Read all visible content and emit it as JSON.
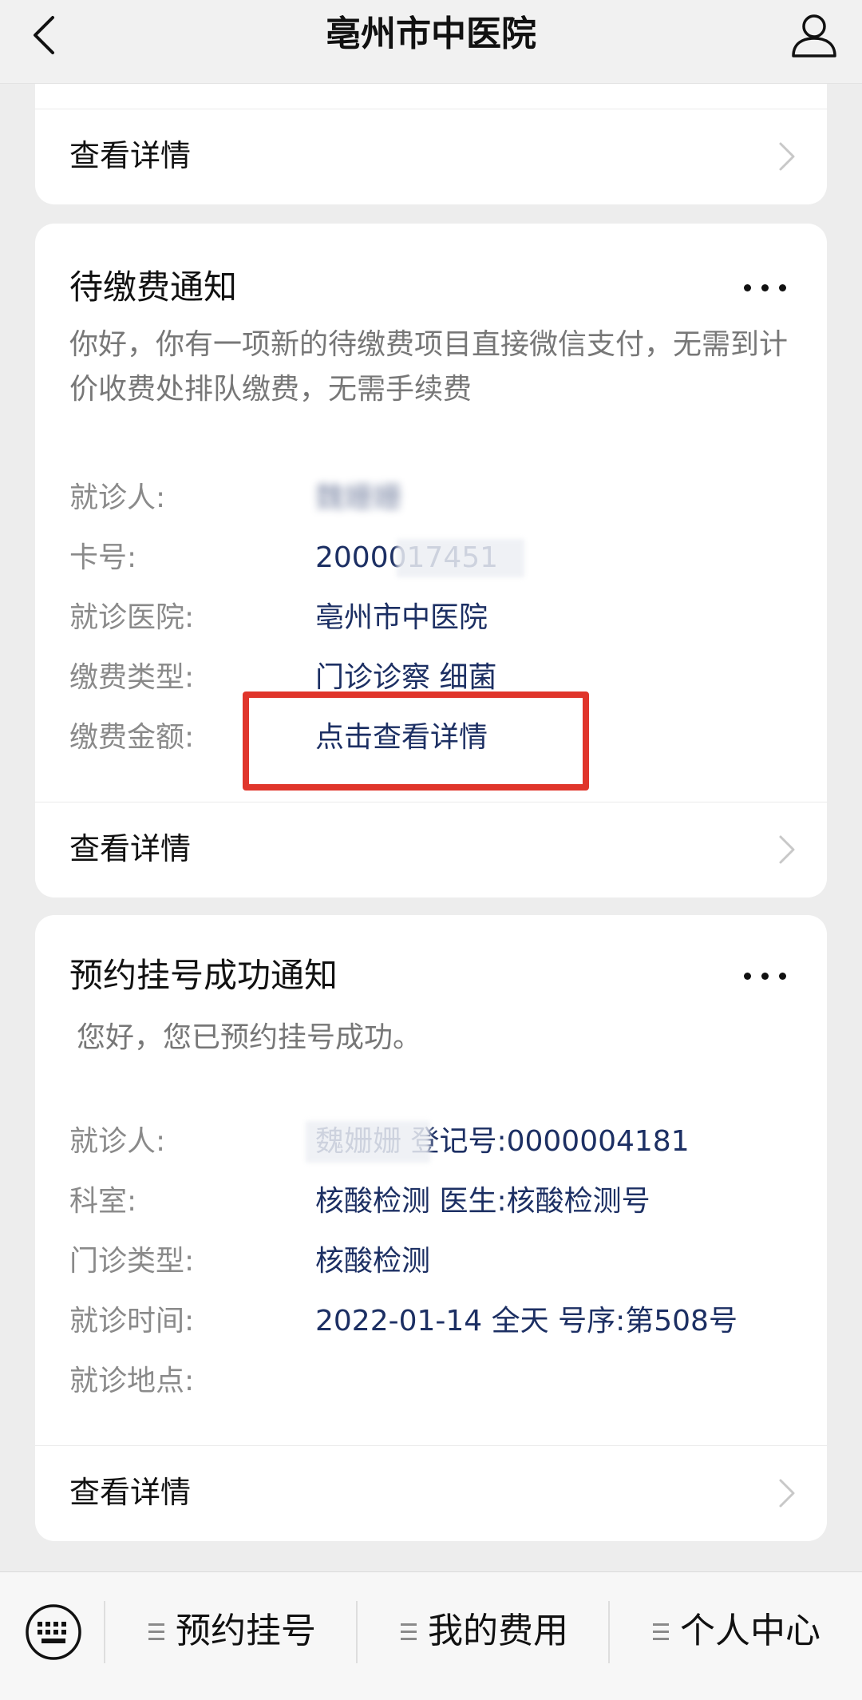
{
  "header": {
    "title": "亳州市中医院"
  },
  "top_card": {
    "detail_label": "查看详情"
  },
  "fee_card": {
    "title": "待缴费通知",
    "description": "你好，你有一项新的待缴费项目直接微信支付，无需到计价收费处排队缴费，无需手续费",
    "fields": [
      {
        "label": "就诊人:",
        "value": "魏姗姗"
      },
      {
        "label": "卡号:",
        "value": "2000017451"
      },
      {
        "label": "就诊医院:",
        "value": "亳州市中医院"
      },
      {
        "label": "缴费类型:",
        "value": "门诊诊察 细菌"
      },
      {
        "label": "缴费金额:",
        "value": "点击查看详情"
      }
    ],
    "detail_label": "查看详情"
  },
  "appt_card": {
    "title": "预约挂号成功通知",
    "description": "您好，您已预约挂号成功。",
    "fields": [
      {
        "label": "就诊人:",
        "value": "魏姗姗 登记号:0000004181"
      },
      {
        "label": "科室:",
        "value": "核酸检测 医生:核酸检测号"
      },
      {
        "label": "门诊类型:",
        "value": "核酸检测"
      },
      {
        "label": "就诊时间:",
        "value": "2022-01-14 全天 号序:第508号"
      },
      {
        "label": "就诊地点:",
        "value": ""
      }
    ],
    "detail_label": "查看详情"
  },
  "bottom_menu": {
    "items": [
      {
        "label": "预约挂号"
      },
      {
        "label": "我的费用"
      },
      {
        "label": "个人中心"
      }
    ]
  },
  "icons": {
    "back": "chevron-left-icon",
    "user": "user-icon",
    "more": "more-dots-icon",
    "chevron": "chevron-right-icon",
    "keyboard": "keyboard-icon",
    "menu": "menu-lines-icon"
  },
  "colors": {
    "value_text": "#1c2f63",
    "highlight_box": "#e0352b"
  }
}
